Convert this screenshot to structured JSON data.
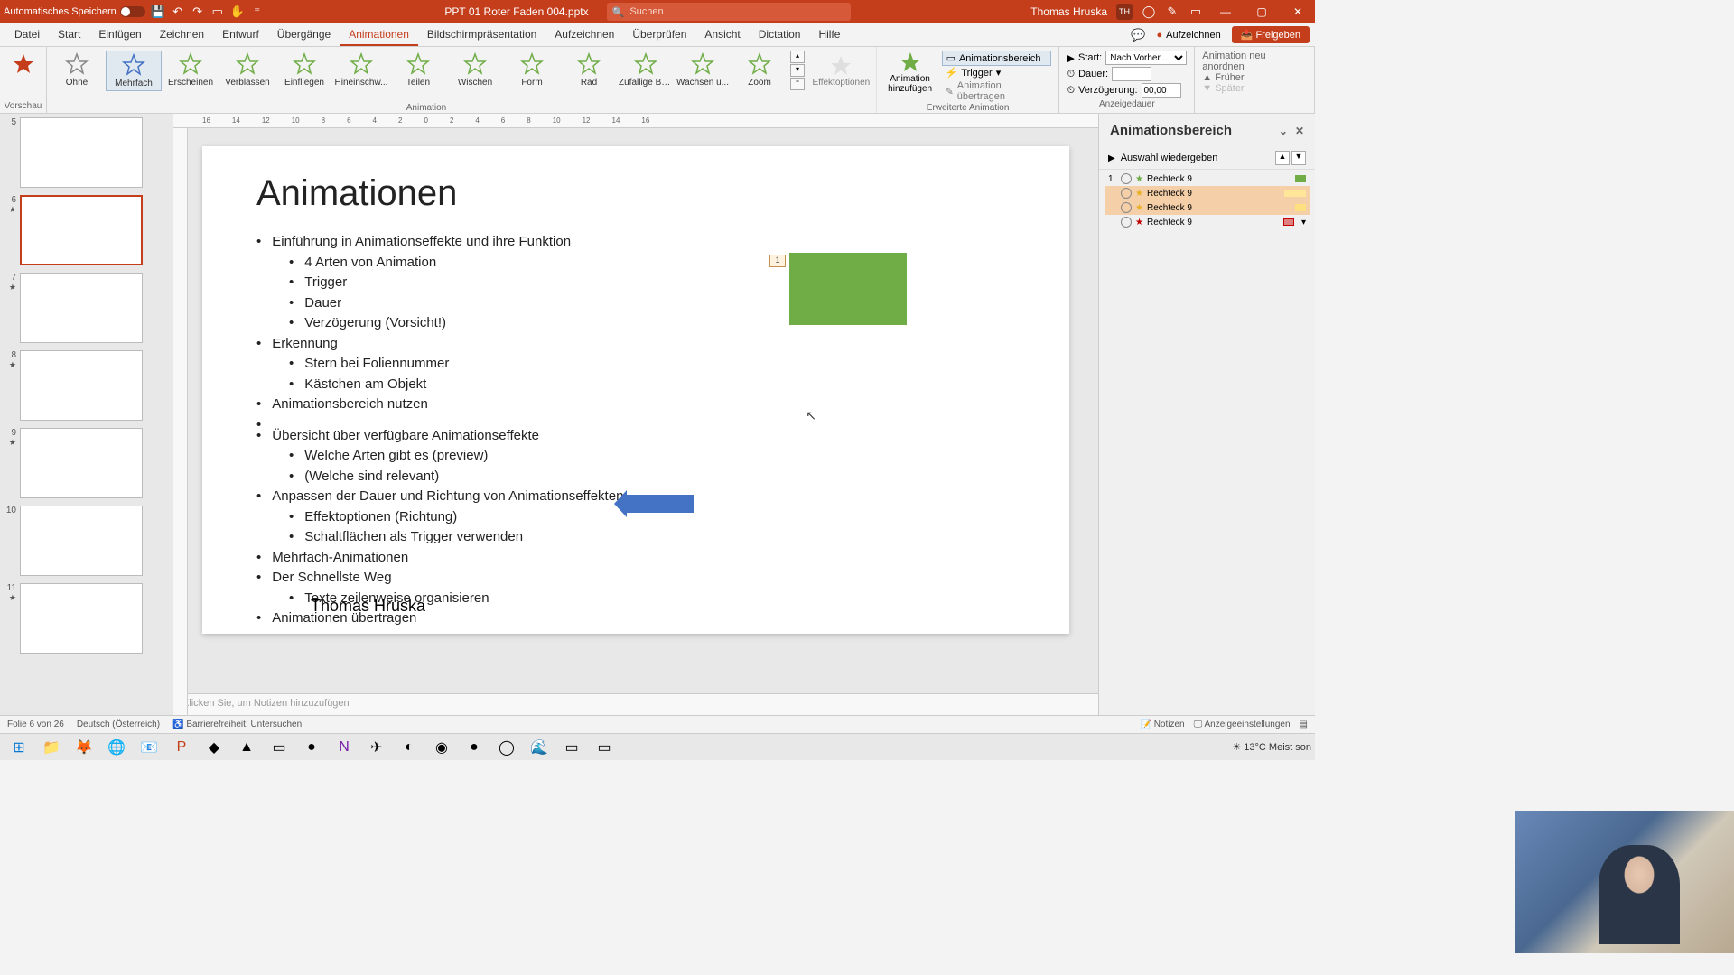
{
  "titlebar": {
    "autosave": "Automatisches Speichern",
    "filename": "PPT 01 Roter Faden 004.pptx",
    "search_placeholder": "Suchen",
    "user": "Thomas Hruska",
    "user_initials": "TH"
  },
  "menu": {
    "items": [
      "Datei",
      "Start",
      "Einfügen",
      "Zeichnen",
      "Entwurf",
      "Übergänge",
      "Animationen",
      "Bildschirmpräsentation",
      "Aufzeichnen",
      "Überprüfen",
      "Ansicht",
      "Dictation",
      "Hilfe"
    ],
    "active_index": 6,
    "record": "Aufzeichnen",
    "share": "Freigeben"
  },
  "ribbon": {
    "preview": "Vorschau",
    "gallery": [
      {
        "label": "Ohne",
        "color": "#888"
      },
      {
        "label": "Mehrfach",
        "color": "#4472c4",
        "selected": true
      },
      {
        "label": "Erscheinen",
        "color": "#70ad47"
      },
      {
        "label": "Verblassen",
        "color": "#70ad47"
      },
      {
        "label": "Einfliegen",
        "color": "#70ad47"
      },
      {
        "label": "Hineinschw...",
        "color": "#70ad47"
      },
      {
        "label": "Teilen",
        "color": "#70ad47"
      },
      {
        "label": "Wischen",
        "color": "#70ad47"
      },
      {
        "label": "Form",
        "color": "#70ad47"
      },
      {
        "label": "Rad",
        "color": "#70ad47"
      },
      {
        "label": "Zufällige Ba...",
        "color": "#70ad47"
      },
      {
        "label": "Wachsen u...",
        "color": "#70ad47"
      },
      {
        "label": "Zoom",
        "color": "#70ad47"
      }
    ],
    "gallery_group": "Animation",
    "effect_options": "Effektoptionen",
    "add_anim": "Animation hinzufügen",
    "anim_pane_btn": "Animationsbereich",
    "trigger": "Trigger",
    "transfer": "Animation übertragen",
    "adv_group": "Erweiterte Animation",
    "start_label": "Start:",
    "start_value": "Nach Vorher...",
    "duration_label": "Dauer:",
    "duration_value": "",
    "delay_label": "Verzögerung:",
    "delay_value": "00,00",
    "reorder_title": "Animation neu anordnen",
    "reorder_earlier": "Früher",
    "reorder_later": "Später",
    "timing_group": "Anzeigedauer"
  },
  "thumbs": [
    {
      "num": "5"
    },
    {
      "num": "6",
      "selected": true,
      "star": true
    },
    {
      "num": "7",
      "star": true
    },
    {
      "num": "8",
      "star": true
    },
    {
      "num": "9",
      "star": true
    },
    {
      "num": "10"
    },
    {
      "num": "11",
      "star": true
    }
  ],
  "slide": {
    "title": "Animationen",
    "bullets": [
      {
        "t": "Einführung in Animationseffekte und ihre Funktion",
        "l": 0
      },
      {
        "t": "4 Arten von Animation",
        "l": 1
      },
      {
        "t": "Trigger",
        "l": 1
      },
      {
        "t": "Dauer",
        "l": 1
      },
      {
        "t": "Verzögerung (Vorsicht!)",
        "l": 1
      },
      {
        "t": "Erkennung",
        "l": 0
      },
      {
        "t": "Stern bei Foliennummer",
        "l": 1
      },
      {
        "t": "Kästchen am Objekt",
        "l": 1
      },
      {
        "t": "Animationsbereich nutzen",
        "l": 0
      },
      {
        "t": "",
        "l": 0,
        "blank": true
      },
      {
        "t": "Übersicht über verfügbare Animationseffekte",
        "l": 0
      },
      {
        "t": "Welche Arten gibt es (preview)",
        "l": 1
      },
      {
        "t": "(Welche sind relevant)",
        "l": 1
      },
      {
        "t": "Anpassen der Dauer und Richtung von Animationseffekten",
        "l": 0
      },
      {
        "t": "Effektoptionen (Richtung)",
        "l": 1
      },
      {
        "t": "Schaltflächen als Trigger verwenden",
        "l": 1
      },
      {
        "t": "Mehrfach-Animationen",
        "l": 0
      },
      {
        "t": "Der Schnellste Weg",
        "l": 0
      },
      {
        "t": "Texte zeilenweise organisieren",
        "l": 1
      },
      {
        "t": "Animationen übertragen",
        "l": 0
      }
    ],
    "anim_tag": "1",
    "author": "Thomas Hruska"
  },
  "notes_placeholder": "Klicken Sie, um Notizen hinzuzufügen",
  "anim_pane": {
    "title": "Animationsbereich",
    "play": "Auswahl wiedergeben",
    "entries": [
      {
        "num": "1",
        "name": "Rechteck 9",
        "kind": "g",
        "bar": "tl-green"
      },
      {
        "num": "",
        "name": "Rechteck 9",
        "kind": "y",
        "bar": "tl-yellow",
        "sel": true
      },
      {
        "num": "",
        "name": "Rechteck 9",
        "kind": "y",
        "bar": "tl-yellow2",
        "sel": true
      },
      {
        "num": "",
        "name": "Rechteck 9",
        "kind": "r",
        "bar": "tl-red"
      }
    ]
  },
  "status": {
    "slide_info": "Folie 6 von 26",
    "language": "Deutsch (Österreich)",
    "accessibility": "Barrierefreiheit: Untersuchen",
    "notes_btn": "Notizen",
    "display_settings": "Anzeigeeinstellungen"
  },
  "taskbar": {
    "weather": "13°C  Meist son"
  }
}
